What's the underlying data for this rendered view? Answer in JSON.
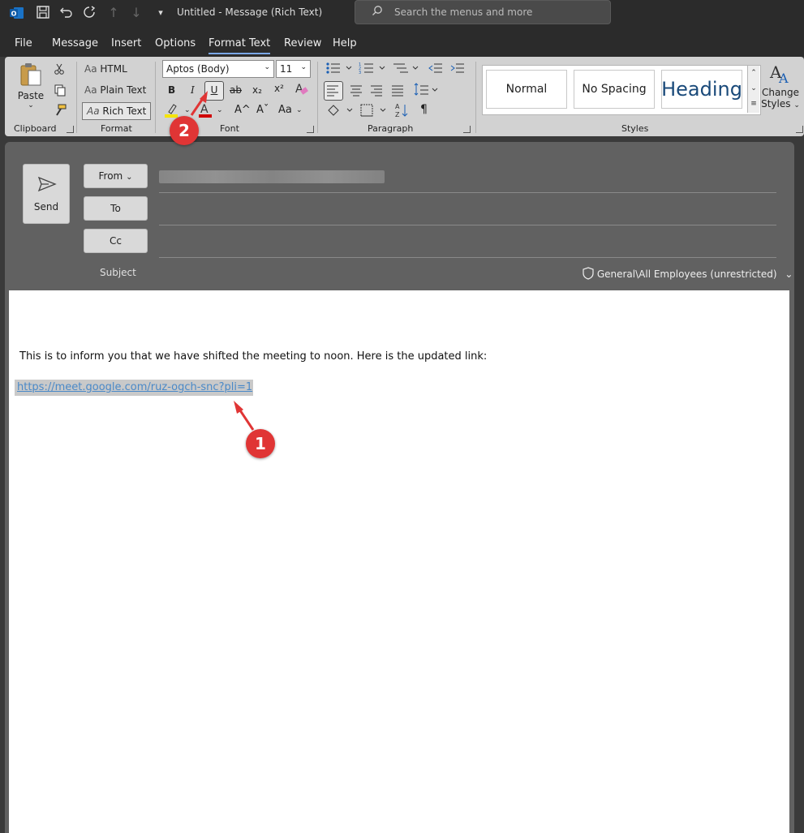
{
  "titlebar": {
    "title": "Untitled  -  Message (Rich Text)",
    "search_placeholder": "Search the menus and more"
  },
  "menu": {
    "tabs": [
      "File",
      "Message",
      "Insert",
      "Options",
      "Format Text",
      "Review",
      "Help"
    ],
    "active_tab": "Format Text"
  },
  "ribbon": {
    "clipboard": {
      "paste_label": "Paste",
      "group_label": "Clipboard"
    },
    "format": {
      "html_label": "HTML",
      "plain_label": "Plain Text",
      "rich_label": "Rich Text",
      "group_label": "Format"
    },
    "font": {
      "font_name": "Aptos (Body)",
      "font_size": "11",
      "group_label": "Font",
      "bold": "B",
      "italic": "I",
      "underline": "U",
      "strike": "ab",
      "subscript": "x₂",
      "superscript": "x²",
      "grow": "A^",
      "shrink": "Aˇ",
      "case": "Aa"
    },
    "paragraph": {
      "group_label": "Paragraph"
    },
    "styles": {
      "normal": "Normal",
      "no_spacing": "No Spacing",
      "heading": "Heading",
      "change_styles_1": "Change",
      "change_styles_2": "Styles",
      "group_label": "Styles"
    }
  },
  "compose": {
    "send_label": "Send",
    "from_label": "From",
    "to_label": "To",
    "cc_label": "Cc",
    "subject_label": "Subject",
    "sensitivity": "General\\All Employees (unrestricted)"
  },
  "body": {
    "text": "This is to inform you that we have shifted the meeting to noon. Here is the updated link:",
    "link": "https://meet.google.com/ruz-ogch-snc?pli=1"
  },
  "callouts": {
    "one": "1",
    "two": "2"
  },
  "colors": {
    "accent_red": "#e03535",
    "link": "#4a89c8",
    "highlight_yellow": "#f5e400",
    "font_red": "#d00000"
  }
}
